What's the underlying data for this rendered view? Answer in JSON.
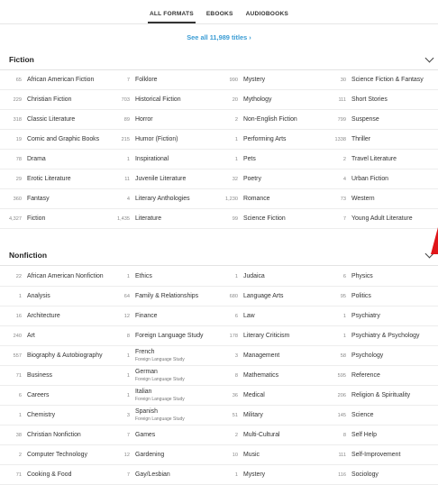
{
  "tabs": [
    {
      "label": "ALL FORMATS",
      "active": true
    },
    {
      "label": "EBOOKS",
      "active": false
    },
    {
      "label": "AUDIOBOOKS",
      "active": false
    }
  ],
  "see_all": "See all 11,989 titles ›",
  "sections": [
    {
      "title": "Fiction",
      "rows": [
        [
          {
            "count": "65",
            "name": "African American Fiction"
          },
          {
            "count": "7",
            "name": "Folklore"
          },
          {
            "count": "990",
            "name": "Mystery"
          },
          {
            "count": "30",
            "name": "Science Fiction & Fantasy"
          }
        ],
        [
          {
            "count": "229",
            "name": "Christian Fiction"
          },
          {
            "count": "703",
            "name": "Historical Fiction"
          },
          {
            "count": "20",
            "name": "Mythology"
          },
          {
            "count": "111",
            "name": "Short Stories"
          }
        ],
        [
          {
            "count": "318",
            "name": "Classic Literature"
          },
          {
            "count": "89",
            "name": "Horror"
          },
          {
            "count": "2",
            "name": "Non-English Fiction"
          },
          {
            "count": "799",
            "name": "Suspense"
          }
        ],
        [
          {
            "count": "19",
            "name": "Comic and Graphic Books"
          },
          {
            "count": "215",
            "name": "Humor (Fiction)"
          },
          {
            "count": "1",
            "name": "Performing Arts"
          },
          {
            "count": "1338",
            "name": "Thriller"
          }
        ],
        [
          {
            "count": "78",
            "name": "Drama"
          },
          {
            "count": "1",
            "name": "Inspirational"
          },
          {
            "count": "1",
            "name": "Pets"
          },
          {
            "count": "2",
            "name": "Travel Literature"
          }
        ],
        [
          {
            "count": "29",
            "name": "Erotic Literature"
          },
          {
            "count": "11",
            "name": "Juvenile Literature"
          },
          {
            "count": "32",
            "name": "Poetry"
          },
          {
            "count": "4",
            "name": "Urban Fiction"
          }
        ],
        [
          {
            "count": "360",
            "name": "Fantasy"
          },
          {
            "count": "4",
            "name": "Literary Anthologies"
          },
          {
            "count": "1,230",
            "name": "Romance"
          },
          {
            "count": "73",
            "name": "Western"
          }
        ],
        [
          {
            "count": "4,327",
            "name": "Fiction"
          },
          {
            "count": "1,435",
            "name": "Literature"
          },
          {
            "count": "99",
            "name": "Science Fiction"
          },
          {
            "count": "7",
            "name": "Young Adult Literature"
          }
        ]
      ]
    },
    {
      "title": "Nonfiction",
      "rows": [
        [
          {
            "count": "22",
            "name": "African American Nonfiction"
          },
          {
            "count": "1",
            "name": "Ethics"
          },
          {
            "count": "1",
            "name": "Judaica"
          },
          {
            "count": "6",
            "name": "Physics"
          }
        ],
        [
          {
            "count": "1",
            "name": "Analysis"
          },
          {
            "count": "64",
            "name": "Family & Relationships"
          },
          {
            "count": "680",
            "name": "Language Arts"
          },
          {
            "count": "95",
            "name": "Politics"
          }
        ],
        [
          {
            "count": "16",
            "name": "Architecture"
          },
          {
            "count": "12",
            "name": "Finance"
          },
          {
            "count": "6",
            "name": "Law"
          },
          {
            "count": "1",
            "name": "Psychiatry"
          }
        ],
        [
          {
            "count": "240",
            "name": "Art"
          },
          {
            "count": "8",
            "name": "Foreign Language Study"
          },
          {
            "count": "178",
            "name": "Literary Criticism"
          },
          {
            "count": "1",
            "name": "Psychiatry & Psychology"
          }
        ],
        [
          {
            "count": "557",
            "name": "Biography & Autobiography"
          },
          {
            "count": "1",
            "name": "French",
            "sub": "Foreign Language Study"
          },
          {
            "count": "3",
            "name": "Management"
          },
          {
            "count": "58",
            "name": "Psychology"
          }
        ],
        [
          {
            "count": "71",
            "name": "Business"
          },
          {
            "count": "1",
            "name": "German",
            "sub": "Foreign Language Study"
          },
          {
            "count": "8",
            "name": "Mathematics"
          },
          {
            "count": "595",
            "name": "Reference"
          }
        ],
        [
          {
            "count": "6",
            "name": "Careers"
          },
          {
            "count": "1",
            "name": "Italian",
            "sub": "Foreign Language Study"
          },
          {
            "count": "36",
            "name": "Medical"
          },
          {
            "count": "206",
            "name": "Religion & Spirituality"
          }
        ],
        [
          {
            "count": "1",
            "name": "Chemistry"
          },
          {
            "count": "3",
            "name": "Spanish",
            "sub": "Foreign Language Study"
          },
          {
            "count": "51",
            "name": "Military"
          },
          {
            "count": "145",
            "name": "Science"
          }
        ],
        [
          {
            "count": "38",
            "name": "Christian Nonfiction"
          },
          {
            "count": "7",
            "name": "Games"
          },
          {
            "count": "2",
            "name": "Multi-Cultural"
          },
          {
            "count": "8",
            "name": "Self Help"
          }
        ],
        [
          {
            "count": "2",
            "name": "Computer Technology"
          },
          {
            "count": "12",
            "name": "Gardening"
          },
          {
            "count": "10",
            "name": "Music"
          },
          {
            "count": "111",
            "name": "Self-Improvement"
          }
        ],
        [
          {
            "count": "71",
            "name": "Cooking & Food"
          },
          {
            "count": "7",
            "name": "Gay/Lesbian"
          },
          {
            "count": "1",
            "name": "Mystery"
          },
          {
            "count": "116",
            "name": "Sociology"
          }
        ]
      ]
    }
  ],
  "colors": {
    "link": "#3a9cd4",
    "marker": "#e0161a"
  }
}
